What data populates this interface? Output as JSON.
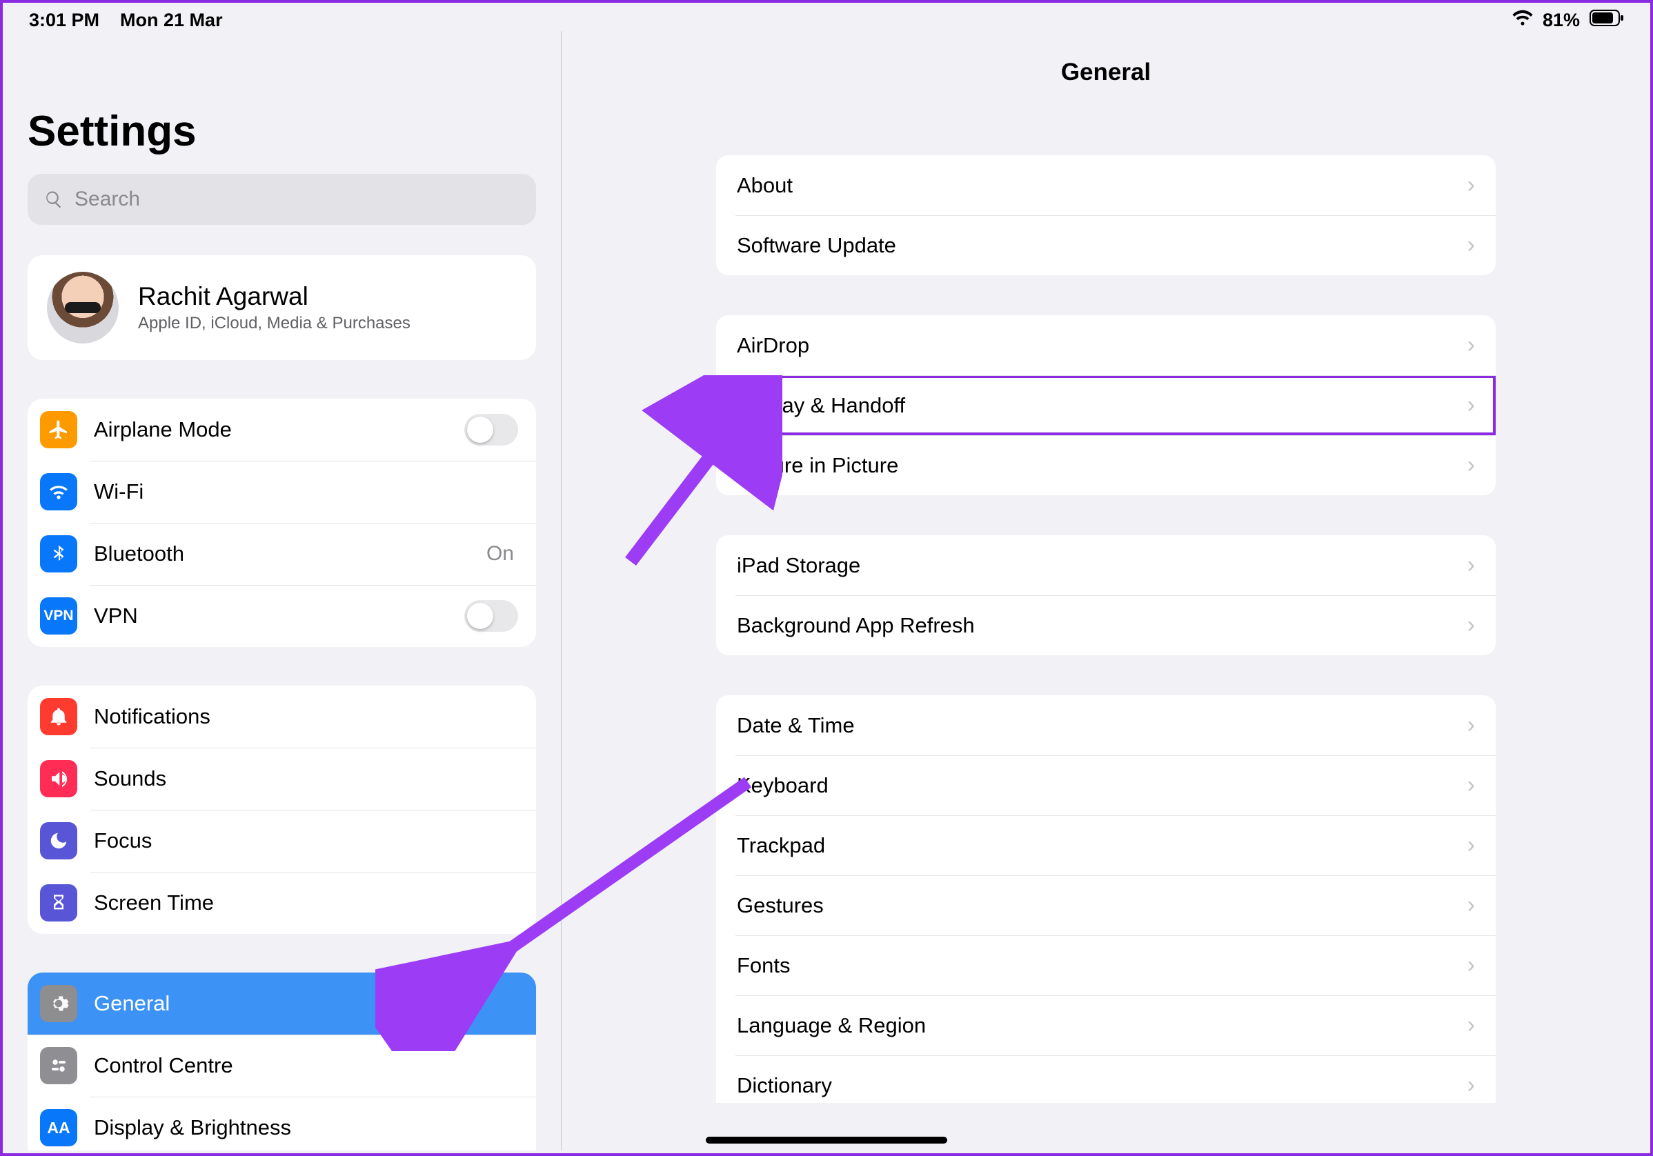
{
  "status": {
    "time": "3:01 PM",
    "date": "Mon 21 Mar",
    "battery_pct": "81%"
  },
  "sidebar": {
    "title": "Settings",
    "search_placeholder": "Search",
    "profile": {
      "name": "Rachit Agarwal",
      "subtitle": "Apple ID, iCloud, Media & Purchases"
    },
    "group1": [
      {
        "id": "airplane",
        "label": "Airplane Mode",
        "icon": "airplane",
        "bg": "bg-orange",
        "accessory": "toggle"
      },
      {
        "id": "wifi",
        "label": "Wi-Fi",
        "icon": "wifi",
        "bg": "bg-blue",
        "accessory": "value",
        "value": ""
      },
      {
        "id": "bluetooth",
        "label": "Bluetooth",
        "icon": "bluetooth",
        "bg": "bg-blue",
        "accessory": "value",
        "value": "On"
      },
      {
        "id": "vpn",
        "label": "VPN",
        "icon": "vpn",
        "bg": "bg-vpn",
        "accessory": "toggle"
      }
    ],
    "group2": [
      {
        "id": "notifications",
        "label": "Notifications",
        "icon": "bell",
        "bg": "bg-red"
      },
      {
        "id": "sounds",
        "label": "Sounds",
        "icon": "speaker",
        "bg": "bg-pink"
      },
      {
        "id": "focus",
        "label": "Focus",
        "icon": "moon",
        "bg": "bg-indigo"
      },
      {
        "id": "screentime",
        "label": "Screen Time",
        "icon": "hourglass",
        "bg": "bg-indigo"
      }
    ],
    "group3": [
      {
        "id": "general",
        "label": "General",
        "icon": "gear",
        "bg": "bg-gray",
        "selected": true
      },
      {
        "id": "controlcentre",
        "label": "Control Centre",
        "icon": "switches",
        "bg": "bg-gray"
      },
      {
        "id": "display",
        "label": "Display & Brightness",
        "icon": "aa",
        "bg": "bg-aa"
      }
    ]
  },
  "detail": {
    "title": "General",
    "groups": [
      [
        {
          "label": "About"
        },
        {
          "label": "Software Update"
        }
      ],
      [
        {
          "label": "AirDrop"
        },
        {
          "label": "AirPlay & Handoff",
          "highlight": true
        },
        {
          "label": "Picture in Picture"
        }
      ],
      [
        {
          "label": "iPad Storage"
        },
        {
          "label": "Background App Refresh"
        }
      ],
      [
        {
          "label": "Date & Time"
        },
        {
          "label": "Keyboard"
        },
        {
          "label": "Trackpad"
        },
        {
          "label": "Gestures"
        },
        {
          "label": "Fonts"
        },
        {
          "label": "Language & Region"
        },
        {
          "label": "Dictionary"
        }
      ]
    ]
  },
  "annotations": {
    "arrow_color": "#9c3df5"
  }
}
